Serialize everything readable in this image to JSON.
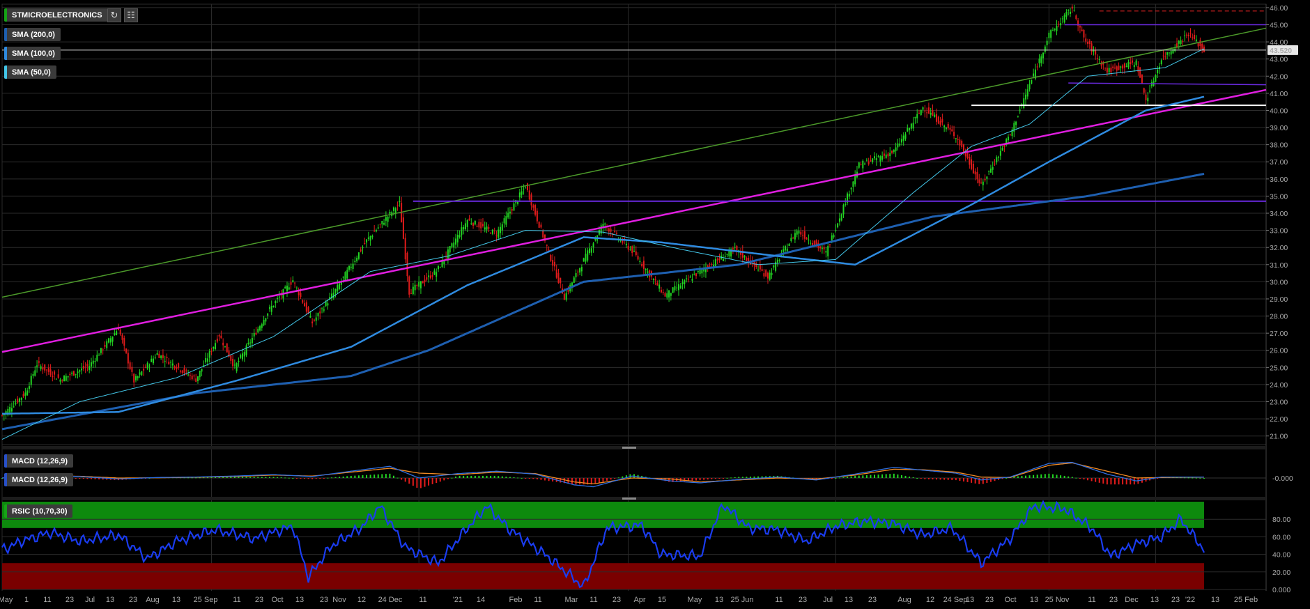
{
  "instrument": "STMICROELECTRONICS",
  "toolbar": {
    "refresh_icon": "refresh-icon",
    "settings_icon": "chart-settings-icon"
  },
  "indicators": {
    "sma200": {
      "label": "SMA (200,0)",
      "color": "#1e5fb0"
    },
    "sma100": {
      "label": "SMA (100,0)",
      "color": "#2f8be0"
    },
    "sma50": {
      "label": "SMA (50,0)",
      "color": "#43c6e8"
    },
    "macd_a": {
      "label": "MACD (12,26,9)",
      "color": "#2850c8"
    },
    "macd_b": {
      "label": "MACD (12,26,9)",
      "color": "#2850c8"
    },
    "rsic": {
      "label": "RSIC (10,70,30)",
      "color": "#16a316"
    }
  },
  "last_price": "43.520",
  "chart_data": [
    {
      "type": "candlestick",
      "title": "STMICROELECTRONICS",
      "ylim": [
        20.5,
        46.2
      ],
      "y_ticks": [
        "46.00",
        "45.00",
        "44.00",
        "43.00",
        "42.00",
        "41.00",
        "40.00",
        "39.00",
        "38.00",
        "37.00",
        "36.00",
        "35.00",
        "34.00",
        "33.00",
        "32.00",
        "31.00",
        "30.00",
        "29.00",
        "28.00",
        "27.00",
        "26.00",
        "25.00",
        "24.00",
        "23.00",
        "22.00",
        "21.00"
      ],
      "x_ticks": [
        "May",
        "1",
        "11",
        "23",
        "Jul",
        "13",
        "23",
        "Aug",
        "13",
        "25 Sep",
        "11",
        "23",
        "Oct",
        "13",
        "23",
        "Nov",
        "12",
        "24 Dec",
        "11",
        "'21",
        "14",
        "Feb",
        "11",
        "Mar",
        "11",
        "23",
        "Apr",
        "15",
        "May",
        "13",
        "25 Jun",
        "11",
        "23",
        "Jul",
        "13",
        "23",
        "Aug",
        "12",
        "24 Sep",
        "13",
        "23",
        "Oct",
        "13",
        "25 Nov",
        "11",
        "23",
        "Dec",
        "13",
        "23",
        "'22",
        "13",
        "25 Feb"
      ],
      "price_waypoints": [
        [
          0,
          22.2
        ],
        [
          12,
          23.5
        ],
        [
          18,
          25.2
        ],
        [
          30,
          24.3
        ],
        [
          45,
          25.1
        ],
        [
          60,
          27.3
        ],
        [
          68,
          24.2
        ],
        [
          80,
          25.8
        ],
        [
          100,
          24.3
        ],
        [
          112,
          26.9
        ],
        [
          120,
          25.0
        ],
        [
          138,
          28.4
        ],
        [
          150,
          30.1
        ],
        [
          160,
          27.6
        ],
        [
          172,
          29.5
        ],
        [
          188,
          32.4
        ],
        [
          205,
          34.6
        ],
        [
          210,
          29.4
        ],
        [
          224,
          30.6
        ],
        [
          240,
          33.6
        ],
        [
          255,
          32.8
        ],
        [
          270,
          35.6
        ],
        [
          290,
          29.1
        ],
        [
          310,
          33.4
        ],
        [
          325,
          31.8
        ],
        [
          342,
          29.2
        ],
        [
          360,
          30.6
        ],
        [
          378,
          31.9
        ],
        [
          395,
          30.3
        ],
        [
          410,
          33.0
        ],
        [
          425,
          31.7
        ],
        [
          442,
          36.8
        ],
        [
          460,
          37.6
        ],
        [
          475,
          40.2
        ],
        [
          492,
          38.5
        ],
        [
          505,
          35.6
        ],
        [
          520,
          38.6
        ],
        [
          540,
          44.4
        ],
        [
          552,
          46.0
        ],
        [
          558,
          44.2
        ],
        [
          570,
          42.3
        ],
        [
          585,
          42.8
        ],
        [
          590,
          40.6
        ],
        [
          598,
          43.0
        ],
        [
          612,
          44.5
        ],
        [
          620,
          43.5
        ]
      ],
      "current": 43.52,
      "series": [
        {
          "name": "SMA (200,0)",
          "values": [
            [
              0,
              21.4
            ],
            [
              100,
              23.5
            ],
            [
              180,
              24.5
            ],
            [
              220,
              26.0
            ],
            [
              300,
              30.0
            ],
            [
              380,
              31.0
            ],
            [
              480,
              33.8
            ],
            [
              560,
              35.0
            ],
            [
              620,
              36.3
            ]
          ]
        },
        {
          "name": "SMA (100,0)",
          "values": [
            [
              0,
              22.3
            ],
            [
              60,
              22.4
            ],
            [
              120,
              24.2
            ],
            [
              180,
              26.2
            ],
            [
              240,
              29.8
            ],
            [
              300,
              32.6
            ],
            [
              340,
              32.3
            ],
            [
              400,
              31.5
            ],
            [
              440,
              31.0
            ],
            [
              500,
              34.5
            ],
            [
              540,
              37.0
            ],
            [
              590,
              40.0
            ],
            [
              620,
              40.8
            ]
          ]
        },
        {
          "name": "SMA (50,0)",
          "values": [
            [
              0,
              20.8
            ],
            [
              40,
              23.0
            ],
            [
              90,
              24.4
            ],
            [
              140,
              26.8
            ],
            [
              190,
              30.6
            ],
            [
              230,
              31.5
            ],
            [
              270,
              33.0
            ],
            [
              310,
              32.9
            ],
            [
              350,
              31.9
            ],
            [
              390,
              31.0
            ],
            [
              430,
              31.3
            ],
            [
              470,
              35.2
            ],
            [
              500,
              37.9
            ],
            [
              530,
              39.2
            ],
            [
              560,
              42.0
            ],
            [
              600,
              42.5
            ],
            [
              620,
              43.6
            ]
          ]
        }
      ],
      "trend_lines": [
        {
          "name": "magenta channel",
          "from": [
            0,
            25.9
          ],
          "to": [
            652,
            41.2
          ]
        },
        {
          "name": "green trendline",
          "from": [
            0,
            29.1
          ],
          "to": [
            652,
            44.8
          ]
        },
        {
          "name": "purple support",
          "from": [
            212,
            34.7
          ],
          "to": [
            652,
            34.7
          ]
        },
        {
          "name": "white resistance",
          "from": [
            500,
            40.3
          ],
          "to": [
            652,
            40.3
          ]
        },
        {
          "name": "purple upper",
          "from": [
            548,
            45.0
          ],
          "to": [
            652,
            45.0
          ]
        },
        {
          "name": "purple lower",
          "from": [
            550,
            41.6
          ],
          "to": [
            652,
            41.5
          ]
        },
        {
          "name": "red dashed",
          "from": [
            566,
            45.8
          ],
          "to": [
            652,
            45.8
          ]
        }
      ]
    },
    {
      "type": "macd",
      "label": "MACD (12,26,9)",
      "y_ticks": [
        "-0.000"
      ],
      "macd": [
        [
          0,
          0
        ],
        [
          20,
          0.25
        ],
        [
          40,
          0.15
        ],
        [
          60,
          -0.1
        ],
        [
          80,
          0.05
        ],
        [
          100,
          0.1
        ],
        [
          120,
          0.2
        ],
        [
          140,
          0.35
        ],
        [
          160,
          0.15
        ],
        [
          180,
          0.7
        ],
        [
          200,
          1.2
        ],
        [
          215,
          0.0
        ],
        [
          235,
          0.45
        ],
        [
          255,
          0.7
        ],
        [
          275,
          0.4
        ],
        [
          295,
          -0.7
        ],
        [
          305,
          -0.9
        ],
        [
          325,
          0.2
        ],
        [
          345,
          -0.3
        ],
        [
          360,
          -0.5
        ],
        [
          380,
          -0.15
        ],
        [
          400,
          0.1
        ],
        [
          420,
          -0.2
        ],
        [
          440,
          0.4
        ],
        [
          460,
          1.1
        ],
        [
          475,
          0.8
        ],
        [
          492,
          0.5
        ],
        [
          505,
          -0.2
        ],
        [
          520,
          0.1
        ],
        [
          540,
          1.5
        ],
        [
          552,
          1.6
        ],
        [
          570,
          0.4
        ],
        [
          585,
          -0.3
        ],
        [
          598,
          0.1
        ],
        [
          620,
          0.1
        ]
      ],
      "signal": [
        [
          0,
          0
        ],
        [
          20,
          0.2
        ],
        [
          40,
          0.18
        ],
        [
          60,
          0.0
        ],
        [
          80,
          0.02
        ],
        [
          100,
          0.08
        ],
        [
          120,
          0.15
        ],
        [
          140,
          0.3
        ],
        [
          160,
          0.2
        ],
        [
          180,
          0.6
        ],
        [
          200,
          1.0
        ],
        [
          215,
          0.5
        ],
        [
          235,
          0.35
        ],
        [
          255,
          0.6
        ],
        [
          275,
          0.45
        ],
        [
          295,
          -0.4
        ],
        [
          305,
          -0.6
        ],
        [
          325,
          0.0
        ],
        [
          345,
          -0.1
        ],
        [
          360,
          -0.4
        ],
        [
          380,
          -0.2
        ],
        [
          400,
          0.0
        ],
        [
          420,
          -0.1
        ],
        [
          440,
          0.3
        ],
        [
          460,
          0.9
        ],
        [
          475,
          0.85
        ],
        [
          492,
          0.6
        ],
        [
          505,
          0.1
        ],
        [
          520,
          0.05
        ],
        [
          540,
          1.3
        ],
        [
          552,
          1.55
        ],
        [
          570,
          0.7
        ],
        [
          585,
          0.0
        ],
        [
          598,
          0.05
        ],
        [
          620,
          0.1
        ]
      ]
    },
    {
      "type": "rsi",
      "label": "RSIC (10,70,30)",
      "ylim": [
        0,
        100
      ],
      "overbought": 70,
      "oversold": 30,
      "y_ticks": [
        "80.00",
        "60.00",
        "40.00",
        "20.00",
        "0.000"
      ],
      "values": [
        [
          0,
          45
        ],
        [
          10,
          55
        ],
        [
          25,
          65
        ],
        [
          40,
          55
        ],
        [
          60,
          62
        ],
        [
          75,
          35
        ],
        [
          90,
          55
        ],
        [
          110,
          68
        ],
        [
          130,
          58
        ],
        [
          150,
          72
        ],
        [
          158,
          14
        ],
        [
          170,
          50
        ],
        [
          185,
          70
        ],
        [
          195,
          95
        ],
        [
          208,
          48
        ],
        [
          225,
          30
        ],
        [
          238,
          65
        ],
        [
          250,
          95
        ],
        [
          262,
          68
        ],
        [
          280,
          40
        ],
        [
          300,
          3
        ],
        [
          312,
          70
        ],
        [
          330,
          73
        ],
        [
          340,
          40
        ],
        [
          360,
          38
        ],
        [
          372,
          97
        ],
        [
          385,
          70
        ],
        [
          400,
          68
        ],
        [
          415,
          55
        ],
        [
          430,
          72
        ],
        [
          445,
          78
        ],
        [
          460,
          75
        ],
        [
          475,
          62
        ],
        [
          490,
          70
        ],
        [
          505,
          30
        ],
        [
          520,
          58
        ],
        [
          532,
          95
        ],
        [
          548,
          92
        ],
        [
          562,
          70
        ],
        [
          572,
          38
        ],
        [
          585,
          52
        ],
        [
          598,
          60
        ],
        [
          608,
          80
        ],
        [
          620,
          45
        ]
      ]
    }
  ]
}
